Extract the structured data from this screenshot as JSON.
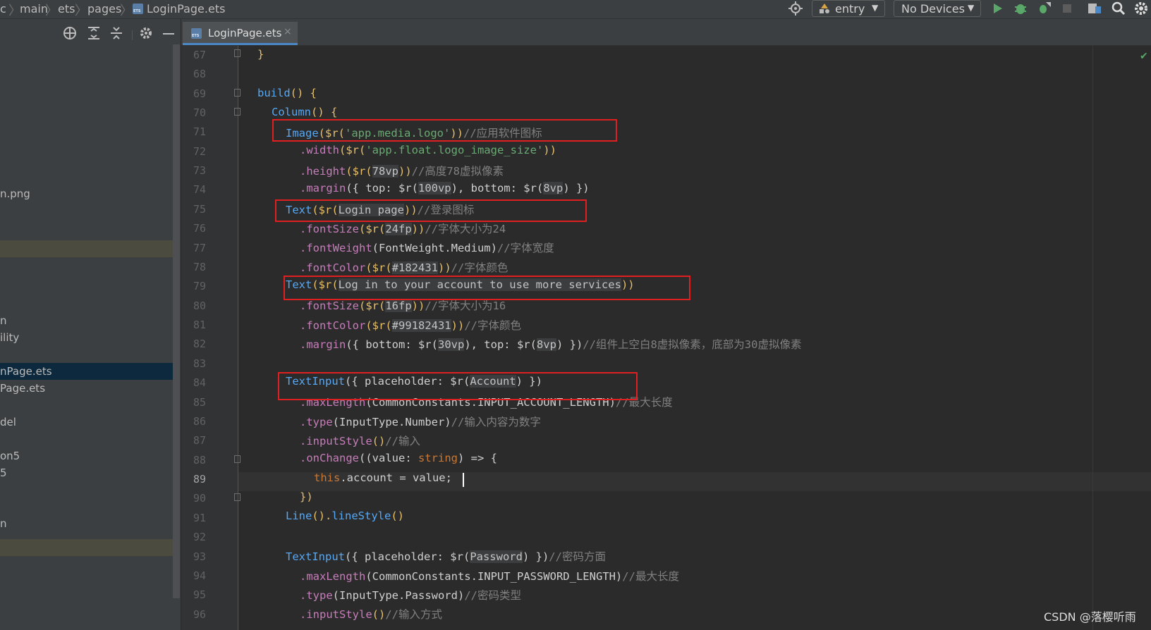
{
  "breadcrumbs": [
    "c",
    "main",
    "ets",
    "pages",
    "LoginPage.ets"
  ],
  "toolbar": {
    "module": "entry",
    "device": "No Devices"
  },
  "tab": {
    "label": "LoginPage.ets",
    "close": "×"
  },
  "sidebar": {
    "items": [
      {
        "label": "n.png"
      },
      {
        "label": ""
      },
      {
        "label": "n"
      },
      {
        "label": "ility"
      },
      {
        "label": "nPage.ets"
      },
      {
        "label": "Page.ets"
      },
      {
        "label": "del"
      },
      {
        "label": "on5"
      },
      {
        "label": "5"
      },
      {
        "label": "n"
      },
      {
        "label": ""
      }
    ]
  },
  "editor": {
    "lines": [
      {
        "n": "67"
      },
      {
        "n": "68"
      },
      {
        "n": "69"
      },
      {
        "n": "70"
      },
      {
        "n": "71"
      },
      {
        "n": "72"
      },
      {
        "n": "73"
      },
      {
        "n": "74"
      },
      {
        "n": "75"
      },
      {
        "n": "76"
      },
      {
        "n": "77"
      },
      {
        "n": "78"
      },
      {
        "n": "79"
      },
      {
        "n": "80"
      },
      {
        "n": "81"
      },
      {
        "n": "82"
      },
      {
        "n": "83"
      },
      {
        "n": "84"
      },
      {
        "n": "85"
      },
      {
        "n": "86"
      },
      {
        "n": "87"
      },
      {
        "n": "88"
      },
      {
        "n": "89"
      },
      {
        "n": "90"
      },
      {
        "n": "91"
      },
      {
        "n": "92"
      },
      {
        "n": "93"
      },
      {
        "n": "94"
      },
      {
        "n": "95"
      },
      {
        "n": "96"
      }
    ],
    "code": {
      "l67": "}",
      "l69_fn": "build",
      "l69_rest": "() {",
      "l70_fn": "Column",
      "l70_rest": "() {",
      "l71_fn": "Image",
      "l71_a": "($r(",
      "l71_str": "'app.media.logo'",
      "l71_b": "))",
      "l71_cm": "//应用软件图标",
      "l72_pr": ".width",
      "l72_a": "($r(",
      "l72_str": "'app.float.logo_image_size'",
      "l72_b": "))",
      "l73_pr": ".height",
      "l73_a": "($r(",
      "l73_arg": "78vp",
      "l73_b": "))",
      "l73_cm": "//高度78虚拟像素",
      "l74_pr": ".margin",
      "l74_a": "({ top: $r(",
      "l74_arg1": "100vp",
      "l74_b": "), bottom: $r(",
      "l74_arg2": "8vp",
      "l74_c": ") })",
      "l75_fn": "Text",
      "l75_a": "($r(",
      "l75_arg": "Login page",
      "l75_b": "))",
      "l75_cm": "//登录图标",
      "l76_pr": ".fontSize",
      "l76_a": "($r(",
      "l76_arg": "24fp",
      "l76_b": "))",
      "l76_cm": "//字体大小为24",
      "l77_pr": ".fontWeight",
      "l77_a": "(FontWeight.Medium)",
      "l77_cm": "//字体宽度",
      "l78_pr": ".fontColor",
      "l78_a": "($r(",
      "l78_arg": "#182431",
      "l78_b": "))",
      "l78_cm": "//字体颜色",
      "l79_fn": "Text",
      "l79_a": "($r(",
      "l79_arg": "Log in to your account to use more services",
      "l79_b": "))",
      "l80_pr": ".fontSize",
      "l80_a": "($r(",
      "l80_arg": "16fp",
      "l80_b": "))",
      "l80_cm": "//字体大小为16",
      "l81_pr": ".fontColor",
      "l81_a": "($r(",
      "l81_arg": "#99182431",
      "l81_b": "))",
      "l81_cm": "//字体颜色",
      "l82_pr": ".margin",
      "l82_a": "({ bottom: $r(",
      "l82_arg1": "30vp",
      "l82_b": "), top: $r(",
      "l82_arg2": "8vp",
      "l82_c": ") })",
      "l82_cm": "//组件上空白8虚拟像素，底部为30虚拟像素",
      "l84_fn": "TextInput",
      "l84_a": "({ placeholder: $r(",
      "l84_arg": "Account",
      "l84_b": ") })",
      "l85_pr": ".maxLength",
      "l85_a": "(CommonConstants.INPUT_ACCOUNT_LENGTH)",
      "l85_cm": "//最大长度",
      "l86_pr": ".type",
      "l86_a": "(InputType.Number)",
      "l86_cm": "//输入内容为数字",
      "l87_pr": ".inputStyle",
      "l87_a": "()",
      "l87_cm": "//输入",
      "l88_pr": ".onChange",
      "l88_a": "((value: ",
      "l88_kw": "string",
      "l88_b": ") => {",
      "l89_kw": "this",
      "l89_a": ".account = value;",
      "l90": "})",
      "l91_fn": "Line",
      "l91_a": "().",
      "l91_pr": "lineStyle",
      "l91_b": "()",
      "l93_fn": "TextInput",
      "l93_a": "({ placeholder: $r(",
      "l93_arg": "Password",
      "l93_b": ") })",
      "l93_cm": "//密码方面",
      "l94_pr": ".maxLength",
      "l94_a": "(CommonConstants.INPUT_PASSWORD_LENGTH)",
      "l94_cm": "//最大长度",
      "l95_pr": ".type",
      "l95_a": "(InputType.Password)",
      "l95_cm": "//密码类型",
      "l96_pr": ".inputStyle",
      "l96_a": "()",
      "l96_cm": "//输入方式"
    }
  },
  "watermark": "CSDN @落樱听雨",
  "colors": {
    "highlight_box": "#e02020",
    "accent": "#4a88c7"
  }
}
